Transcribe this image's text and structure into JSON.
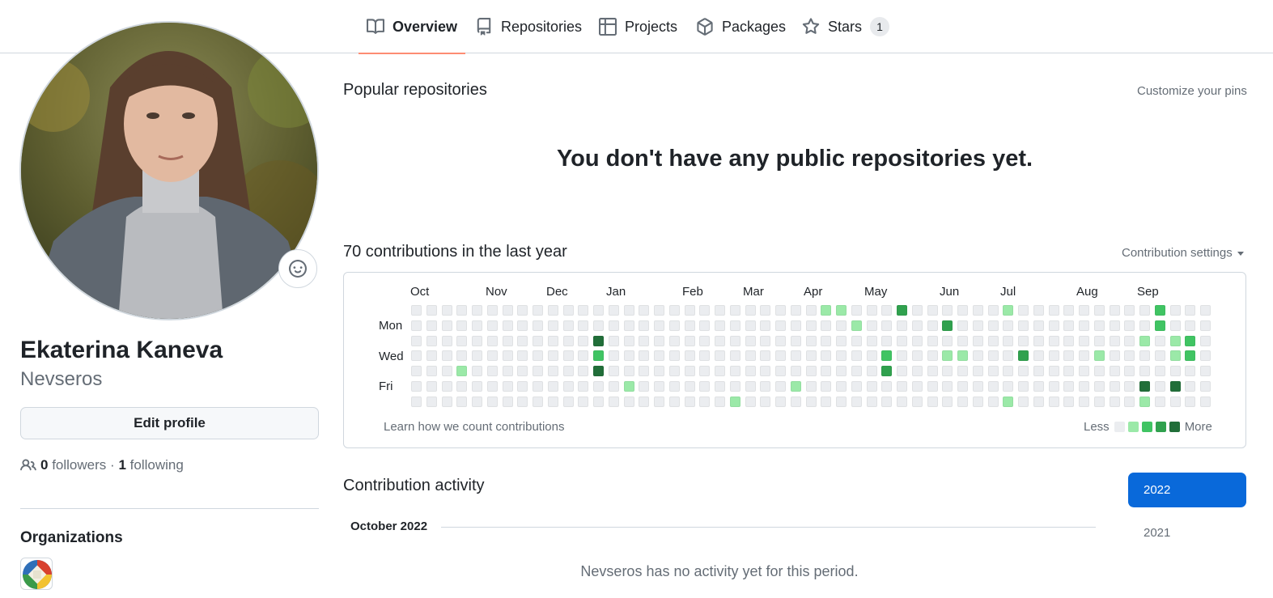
{
  "tabs": [
    {
      "label": "Overview",
      "icon": "book-icon",
      "active": true
    },
    {
      "label": "Repositories",
      "icon": "repo-icon"
    },
    {
      "label": "Projects",
      "icon": "table-icon"
    },
    {
      "label": "Packages",
      "icon": "package-icon"
    },
    {
      "label": "Stars",
      "icon": "star-icon",
      "count": "1"
    }
  ],
  "profile": {
    "full_name": "Ekaterina Kaneva",
    "username": "Nevseros",
    "edit_label": "Edit profile",
    "followers_count": "0",
    "followers_label": "followers",
    "separator": "·",
    "following_count": "1",
    "following_label": "following",
    "organizations_title": "Organizations"
  },
  "popular": {
    "title": "Popular repositories",
    "customize_label": "Customize your pins",
    "empty_message": "You don't have any public repositories yet."
  },
  "contributions": {
    "title": "70 contributions in the last year",
    "settings_label": "Contribution settings",
    "months": [
      "Oct",
      "Nov",
      "Dec",
      "Jan",
      "Feb",
      "Mar",
      "Apr",
      "May",
      "Jun",
      "Jul",
      "Aug",
      "Sep"
    ],
    "days": [
      "Mon",
      "Wed",
      "Fri"
    ],
    "learn_label": "Learn how we count contributions",
    "less_label": "Less",
    "more_label": "More",
    "level_colors": [
      "#ebedf0",
      "#9be9a8",
      "#40c463",
      "#30a14e",
      "#216e39"
    ],
    "weeks": 53,
    "active_cells": [
      {
        "week": 27,
        "day": 0,
        "level": 1
      },
      {
        "week": 28,
        "day": 0,
        "level": 1
      },
      {
        "week": 32,
        "day": 0,
        "level": 3
      },
      {
        "week": 39,
        "day": 0,
        "level": 1
      },
      {
        "week": 49,
        "day": 0,
        "level": 2
      },
      {
        "week": 29,
        "day": 1,
        "level": 1
      },
      {
        "week": 35,
        "day": 1,
        "level": 3
      },
      {
        "week": 49,
        "day": 1,
        "level": 2
      },
      {
        "week": 12,
        "day": 2,
        "level": 4
      },
      {
        "week": 48,
        "day": 2,
        "level": 1
      },
      {
        "week": 50,
        "day": 2,
        "level": 1
      },
      {
        "week": 51,
        "day": 2,
        "level": 2
      },
      {
        "week": 12,
        "day": 3,
        "level": 2
      },
      {
        "week": 31,
        "day": 3,
        "level": 2
      },
      {
        "week": 35,
        "day": 3,
        "level": 1
      },
      {
        "week": 36,
        "day": 3,
        "level": 1
      },
      {
        "week": 40,
        "day": 3,
        "level": 3
      },
      {
        "week": 45,
        "day": 3,
        "level": 1
      },
      {
        "week": 50,
        "day": 3,
        "level": 1
      },
      {
        "week": 51,
        "day": 3,
        "level": 2
      },
      {
        "week": 3,
        "day": 4,
        "level": 1
      },
      {
        "week": 12,
        "day": 4,
        "level": 4
      },
      {
        "week": 31,
        "day": 4,
        "level": 3
      },
      {
        "week": 14,
        "day": 5,
        "level": 1
      },
      {
        "week": 25,
        "day": 5,
        "level": 1
      },
      {
        "week": 48,
        "day": 5,
        "level": 4
      },
      {
        "week": 50,
        "day": 5,
        "level": 4
      },
      {
        "week": 21,
        "day": 6,
        "level": 1
      },
      {
        "week": 39,
        "day": 6,
        "level": 1
      },
      {
        "week": 48,
        "day": 6,
        "level": 1
      }
    ]
  },
  "activity": {
    "title": "Contribution activity",
    "month_label": "October 2022",
    "empty_message": "Nevseros has no activity yet for this period.",
    "years": [
      "2022",
      "2021"
    ]
  }
}
